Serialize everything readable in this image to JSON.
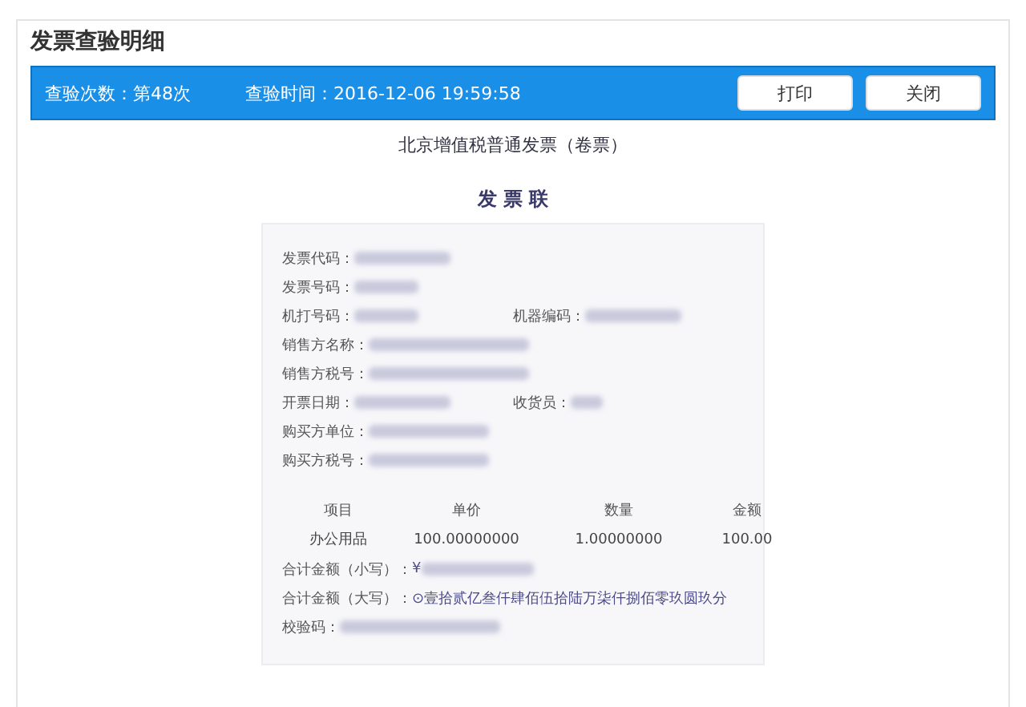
{
  "title": "发票查验明细",
  "info_bar": {
    "count": "查验次数：第48次",
    "time": "查验时间：2016-12-06 19:59:58",
    "buttons": [
      "打印",
      "关闭"
    ]
  },
  "invoice_title": "北京增值税普通发票（卷票）",
  "copy_label": "发 票 联",
  "fields": [
    {
      "label": "发票代码：",
      "redacted": true
    },
    {
      "label": "发票号码：",
      "redacted": true
    },
    {
      "label": "机打号码：",
      "redacted": true,
      "right_label": "机器编码：",
      "right_redacted": true
    },
    {
      "label": "销售方名称：",
      "redacted": true
    },
    {
      "label": "销售方税号：",
      "redacted": true
    },
    {
      "label": "开票日期：",
      "redacted": true,
      "right_label": "收货员：",
      "right_redacted": true
    },
    {
      "label": "购买方单位：",
      "redacted": true
    },
    {
      "label": "购买方税号：",
      "redacted": true
    }
  ],
  "table": {
    "columns": [
      "项目",
      "单价",
      "数量",
      "金额"
    ],
    "rows": [
      [
        "办公用品",
        "100.00000000",
        "1.00000000",
        "100.00"
      ]
    ]
  },
  "totals": [
    {
      "label": "合计金额（小写）：",
      "value": "¥",
      "redacted": true
    },
    {
      "label": "合计金额（大写）：",
      "value": "⊙壹拾贰亿叁仟肆佰伍拾陆万柒仟捌佰零玖圆玖分"
    },
    {
      "label": "校验码：",
      "redacted": true
    }
  ]
}
